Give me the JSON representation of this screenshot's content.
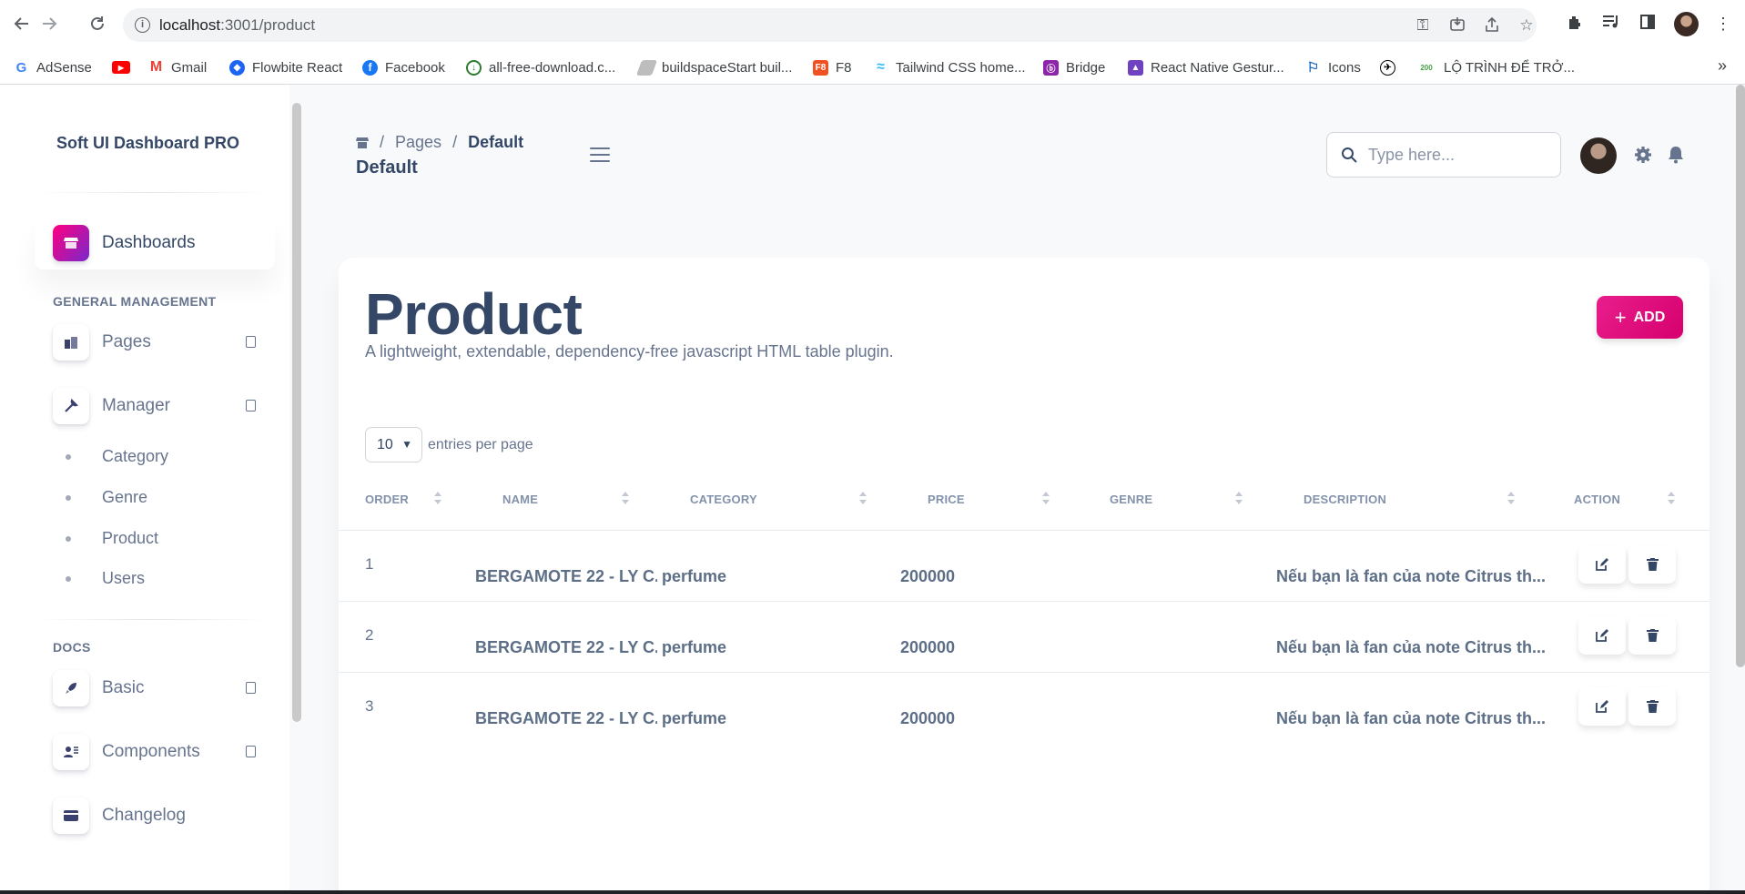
{
  "browser": {
    "url_host": "localhost",
    "url_path": ":3001/product",
    "bookmarks": [
      {
        "label": "AdSense",
        "icon": "google-icon",
        "color": "#ffffff"
      },
      {
        "label": "",
        "icon": "youtube-icon",
        "color": "#ff0000"
      },
      {
        "label": "Gmail",
        "icon": "gmail-icon",
        "color": "#ffffff"
      },
      {
        "label": "Flowbite React",
        "icon": "flowbite-icon",
        "color": "#1c64f2"
      },
      {
        "label": "Facebook",
        "icon": "facebook-icon",
        "color": "#1877f2"
      },
      {
        "label": "all-free-download.c...",
        "icon": "download-site-icon",
        "color": "#2e7d32"
      },
      {
        "label": "buildspaceStart buil...",
        "icon": "buildspace-icon",
        "color": "#9e9e9e"
      },
      {
        "label": "F8",
        "icon": "f8-icon",
        "color": "#f05123"
      },
      {
        "label": "Tailwind CSS home...",
        "icon": "tailwind-icon",
        "color": "#38bdf8"
      },
      {
        "label": "Bridge",
        "icon": "bridge-icon",
        "color": "#8e24aa"
      },
      {
        "label": "React Native Gestur...",
        "icon": "react-native-icon",
        "color": "#6f42c1"
      },
      {
        "label": "Icons",
        "icon": "flag-icon",
        "color": "#1565c0"
      },
      {
        "label": "",
        "icon": "plane-icon",
        "color": "#000000"
      },
      {
        "label": "LỘ TRÌNH ĐỂ TRỞ...",
        "icon": "roadmap-icon",
        "color": "#43a047"
      }
    ],
    "more": "»"
  },
  "sidebar": {
    "brand": "Soft UI Dashboard PRO",
    "dashboards": "Dashboards",
    "section_general": "GENERAL MANAGEMENT",
    "pages": "Pages",
    "manager": "Manager",
    "sub_items": [
      "Category",
      "Genre",
      "Product",
      "Users"
    ],
    "section_docs": "DOCS",
    "basic": "Basic",
    "components": "Components",
    "changelog": "Changelog"
  },
  "header": {
    "crumb_pages": "Pages",
    "crumb_current": "Default",
    "title": "Default",
    "search_placeholder": "Type here..."
  },
  "card": {
    "title": "Product",
    "subtitle": "A lightweight, extendable, dependency-free javascript HTML table plugin.",
    "add_label": "ADD",
    "per_page_value": "10",
    "per_page_label": "entries per page"
  },
  "table": {
    "columns": [
      "ORDER",
      "NAME",
      "CATEGORY",
      "PRICE",
      "GENRE",
      "DESCRIPTION",
      "ACTION"
    ],
    "rows": [
      {
        "order": "1",
        "name": "BERGAMOTE 22 - LY C...",
        "category": "perfume",
        "price": "200000",
        "genre": "",
        "description": "Nếu bạn là fan của note Citrus th..."
      },
      {
        "order": "2",
        "name": "BERGAMOTE 22 - LY C...",
        "category": "perfume",
        "price": "200000",
        "genre": "",
        "description": "Nếu bạn là fan của note Citrus th..."
      },
      {
        "order": "3",
        "name": "BERGAMOTE 22 - LY C...",
        "category": "perfume",
        "price": "200000",
        "genre": "",
        "description": "Nếu bạn là fan của note Citrus th..."
      }
    ]
  },
  "colors": {
    "accent_gradient_start": "#7928ca",
    "accent_gradient_end": "#ff0080",
    "add_button": "#d6006e",
    "text_dark": "#344767",
    "text_muted": "#67748e"
  }
}
